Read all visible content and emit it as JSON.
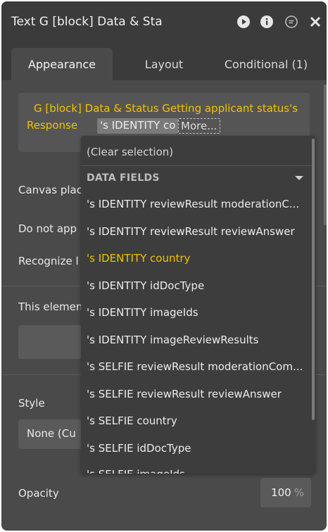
{
  "header": {
    "title": "Text G [block] Data & Sta",
    "icons": [
      "play-icon",
      "info-icon",
      "comment-icon",
      "close-icon"
    ]
  },
  "tabs": [
    {
      "label": "Appearance",
      "active": true
    },
    {
      "label": "Layout",
      "active": false
    },
    {
      "label": "Conditional (1)",
      "active": false
    }
  ],
  "text_content": {
    "line1": "G [block] Data & Status Getting applicant status's",
    "line2_prefix": "Response",
    "selected_chip": "'s IDENTITY co",
    "more_label": "More..."
  },
  "properties": {
    "canvas_placement": "Canvas plac",
    "do_not_apply": "Do not app",
    "recognize": "Recognize l",
    "this_element": "This elemen",
    "style_label": "Style",
    "style_value": "None (Cu",
    "opacity_label": "Opacity",
    "opacity_value": "100",
    "opacity_unit": "%"
  },
  "dropdown": {
    "clear_label": "(Clear selection)",
    "section_label": "DATA FIELDS",
    "items": [
      {
        "label": "'s IDENTITY reviewResult moderationC..."
      },
      {
        "label": "'s IDENTITY reviewResult reviewAnswer"
      },
      {
        "label": "'s IDENTITY country"
      },
      {
        "label": "'s IDENTITY idDocType"
      },
      {
        "label": "'s IDENTITY imageIds"
      },
      {
        "label": "'s IDENTITY imageReviewResults"
      },
      {
        "label": "'s SELFIE reviewResult moderationCom..."
      },
      {
        "label": "'s SELFIE reviewResult reviewAnswer"
      },
      {
        "label": "'s SELFIE country"
      },
      {
        "label": "'s SELFIE idDocType"
      },
      {
        "label": "'s SELFIE imageIds"
      }
    ],
    "highlighted_index": 2
  },
  "colors": {
    "accent": "#f2c200",
    "panel_bg": "#4a4a4a",
    "header_bg": "#3b3b3b",
    "dropdown_bg": "#3d3d3d"
  }
}
